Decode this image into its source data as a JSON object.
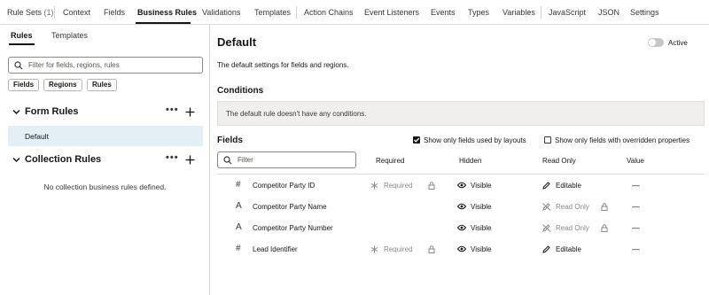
{
  "top_tabs": {
    "rule_sets": "Rule Sets",
    "rule_sets_count": "(1)",
    "context": "Context",
    "fields": "Fields",
    "business_rules": "Business Rules",
    "validations": "Validations",
    "templates": "Templates",
    "action_chains": "Action Chains",
    "event_listeners": "Event Listeners",
    "events": "Events",
    "types": "Types",
    "variables": "Variables",
    "javascript": "JavaScript",
    "json": "JSON",
    "settings": "Settings",
    "active_tab": "Business Rules"
  },
  "left": {
    "tabs": {
      "rules": "Rules",
      "templates": "Templates",
      "active": "Rules"
    },
    "search": {
      "placeholder": "Filter for fields, regions, rules",
      "value": ""
    },
    "chips": {
      "fields": "Fields",
      "regions": "Regions",
      "rules": "Rules"
    },
    "form_rules": {
      "title": "Form Rules",
      "items": [
        {
          "label": "Default",
          "selected": true
        }
      ]
    },
    "collection_rules": {
      "title": "Collection Rules",
      "empty_message": "No collection business rules defined."
    }
  },
  "detail": {
    "title": "Default",
    "active_label": "Active",
    "active": false,
    "description": "The default settings for fields and regions.",
    "conditions_heading": "Conditions",
    "conditions_message": "The default rule doesn't have any conditions.",
    "fields_heading": "Fields",
    "show_used_label": "Show only fields used by layouts",
    "show_used_checked": true,
    "show_overridden_label": "Show only fields with overridden properties",
    "show_overridden_checked": false,
    "filter_placeholder": "Filter",
    "columns": {
      "required": "Required",
      "hidden": "Hidden",
      "read_only": "Read Only",
      "value": "Value"
    },
    "rows": [
      {
        "type_icon": "#",
        "name": "Competitor Party ID",
        "required": "Required",
        "hidden": "Visible",
        "read_only": "Editable",
        "value": "—"
      },
      {
        "type_icon": "A",
        "name": "Competitor Party Name",
        "required": "",
        "hidden": "Visible",
        "read_only": "Read Only",
        "value": "—"
      },
      {
        "type_icon": "A",
        "name": "Competitor Party Number",
        "required": "",
        "hidden": "Visible",
        "read_only": "Read Only",
        "value": "—"
      },
      {
        "type_icon": "#",
        "name": "Lead Identifier",
        "required": "Required",
        "hidden": "Visible",
        "read_only": "Editable",
        "value": "—"
      }
    ]
  },
  "colors": {
    "selected_row_bg": "#e4eff5",
    "border": "#dcdbd8",
    "text": "#161513",
    "muted": "#8b8781",
    "conditions_bg": "#f1efed"
  }
}
